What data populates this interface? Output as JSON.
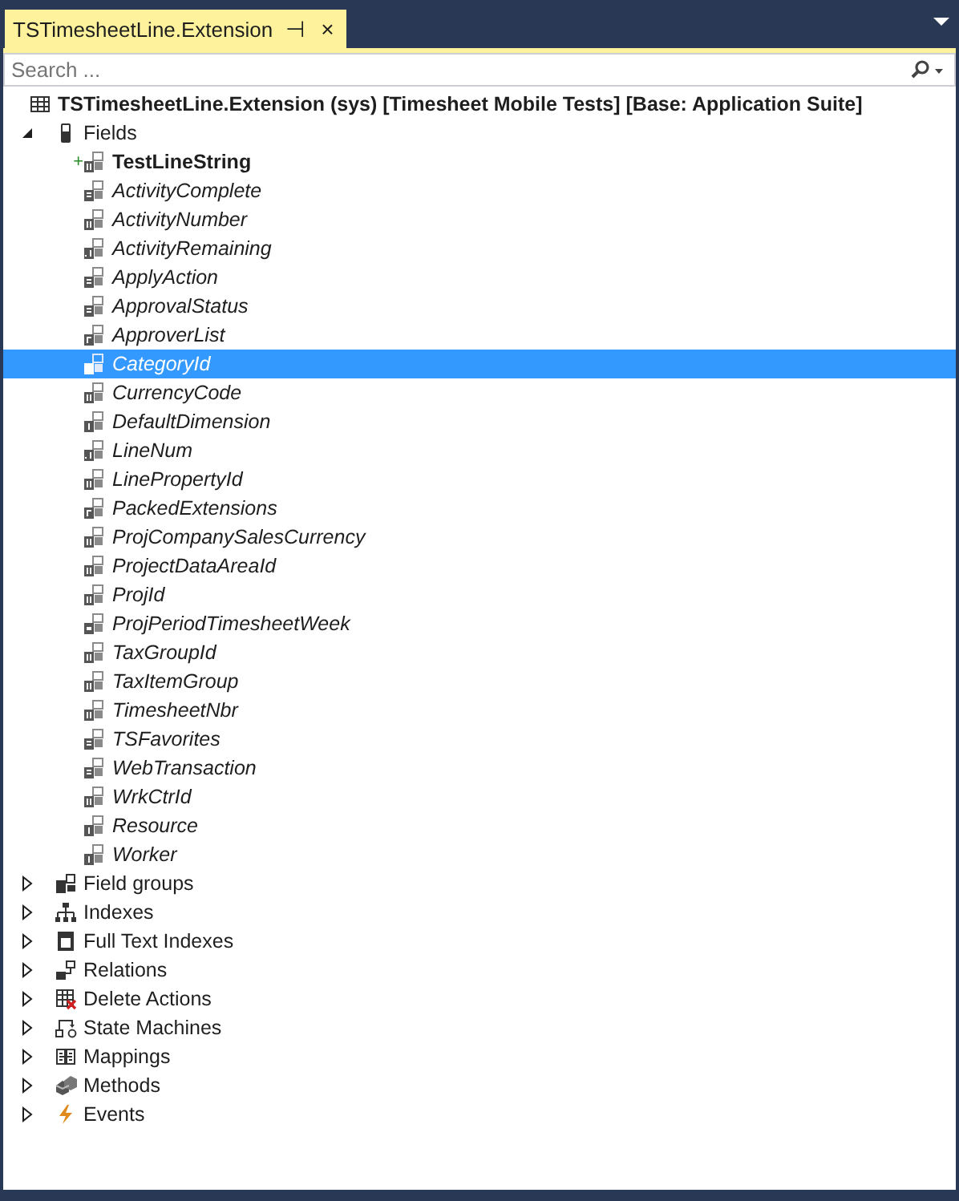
{
  "tab": {
    "title": "TSTimesheetLine.Extension",
    "pin": "⊣",
    "close": "×",
    "selected": true
  },
  "search": {
    "placeholder": "Search ..."
  },
  "tree": {
    "root": {
      "label": "TSTimesheetLine.Extension (sys) [Timesheet Mobile Tests] [Base: Application Suite]",
      "kind": "table",
      "children": [
        {
          "label": "Fields",
          "kind": "fields",
          "expanded": true,
          "children": [
            {
              "label": "TestLineString",
              "kind": "string",
              "badge": "+",
              "added": true,
              "inherited": false,
              "selected": false
            },
            {
              "label": "ActivityComplete",
              "kind": "enum",
              "added": false,
              "inherited": true,
              "selected": false
            },
            {
              "label": "ActivityNumber",
              "kind": "string",
              "added": false,
              "inherited": true,
              "selected": false
            },
            {
              "label": "ActivityRemaining",
              "kind": "real",
              "added": false,
              "inherited": true,
              "selected": false
            },
            {
              "label": "ApplyAction",
              "kind": "enum",
              "added": false,
              "inherited": true,
              "selected": false
            },
            {
              "label": "ApprovalStatus",
              "kind": "enum",
              "added": false,
              "inherited": true,
              "selected": false
            },
            {
              "label": "ApproverList",
              "kind": "container",
              "added": false,
              "inherited": true,
              "selected": false
            },
            {
              "label": "CategoryId",
              "kind": "string",
              "added": false,
              "inherited": true,
              "selected": true
            },
            {
              "label": "CurrencyCode",
              "kind": "string",
              "added": false,
              "inherited": true,
              "selected": false
            },
            {
              "label": "DefaultDimension",
              "kind": "int",
              "added": false,
              "inherited": true,
              "selected": false
            },
            {
              "label": "LineNum",
              "kind": "real",
              "added": false,
              "inherited": true,
              "selected": false
            },
            {
              "label": "LinePropertyId",
              "kind": "string",
              "added": false,
              "inherited": true,
              "selected": false
            },
            {
              "label": "PackedExtensions",
              "kind": "container",
              "added": false,
              "inherited": true,
              "selected": false
            },
            {
              "label": "ProjCompanySalesCurrency",
              "kind": "string",
              "added": false,
              "inherited": true,
              "selected": false
            },
            {
              "label": "ProjectDataAreaId",
              "kind": "string",
              "added": false,
              "inherited": true,
              "selected": false
            },
            {
              "label": "ProjId",
              "kind": "string",
              "added": false,
              "inherited": true,
              "selected": false
            },
            {
              "label": "ProjPeriodTimesheetWeek",
              "kind": "date",
              "added": false,
              "inherited": true,
              "selected": false
            },
            {
              "label": "TaxGroupId",
              "kind": "string",
              "added": false,
              "inherited": true,
              "selected": false
            },
            {
              "label": "TaxItemGroup",
              "kind": "string",
              "added": false,
              "inherited": true,
              "selected": false
            },
            {
              "label": "TimesheetNbr",
              "kind": "string",
              "added": false,
              "inherited": true,
              "selected": false
            },
            {
              "label": "TSFavorites",
              "kind": "enum",
              "added": false,
              "inherited": true,
              "selected": false
            },
            {
              "label": "WebTransaction",
              "kind": "enum",
              "added": false,
              "inherited": true,
              "selected": false
            },
            {
              "label": "WrkCtrId",
              "kind": "string",
              "added": false,
              "inherited": true,
              "selected": false
            },
            {
              "label": "Resource",
              "kind": "int",
              "added": false,
              "inherited": true,
              "selected": false
            },
            {
              "label": "Worker",
              "kind": "int",
              "added": false,
              "inherited": true,
              "selected": false
            }
          ]
        },
        {
          "label": "Field groups",
          "kind": "field-groups",
          "expanded": false
        },
        {
          "label": "Indexes",
          "kind": "indexes",
          "expanded": false
        },
        {
          "label": "Full Text Indexes",
          "kind": "full-text",
          "expanded": false
        },
        {
          "label": "Relations",
          "kind": "relations",
          "expanded": false
        },
        {
          "label": "Delete Actions",
          "kind": "delete-actions",
          "expanded": false
        },
        {
          "label": "State Machines",
          "kind": "state-machines",
          "expanded": false
        },
        {
          "label": "Mappings",
          "kind": "mappings",
          "expanded": false
        },
        {
          "label": "Methods",
          "kind": "methods",
          "expanded": false
        },
        {
          "label": "Events",
          "kind": "events",
          "expanded": false
        }
      ]
    }
  }
}
